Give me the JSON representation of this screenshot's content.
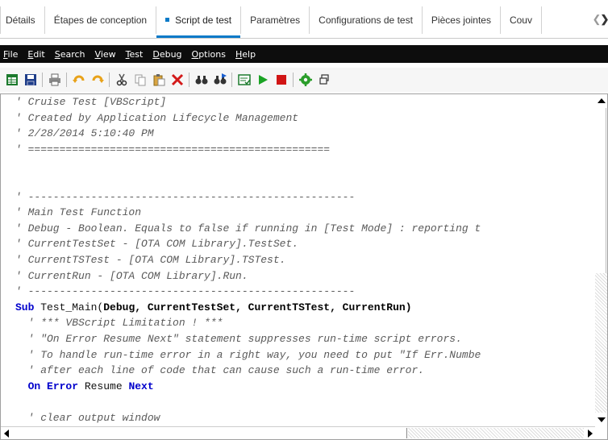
{
  "tabs": [
    {
      "label": "Détails",
      "active": false
    },
    {
      "label": "Étapes de conception",
      "active": false
    },
    {
      "label": "Script de test",
      "active": true
    },
    {
      "label": "Paramètres",
      "active": false
    },
    {
      "label": "Configurations de test",
      "active": false
    },
    {
      "label": "Pièces jointes",
      "active": false
    },
    {
      "label": "Couv",
      "active": false
    }
  ],
  "menu": [
    {
      "label": "File",
      "mnemonic": "F",
      "rest": "ile"
    },
    {
      "label": "Edit",
      "mnemonic": "E",
      "rest": "dit"
    },
    {
      "label": "Search",
      "mnemonic": "S",
      "rest": "earch"
    },
    {
      "label": "View",
      "mnemonic": "V",
      "rest": "iew"
    },
    {
      "label": "Test",
      "mnemonic": "T",
      "rest": "est"
    },
    {
      "label": "Debug",
      "mnemonic": "D",
      "rest": "ebug"
    },
    {
      "label": "Options",
      "mnemonic": "O",
      "rest": "ptions"
    },
    {
      "label": "Help",
      "mnemonic": "H",
      "rest": "elp"
    }
  ],
  "toolbar": {
    "icons": [
      "grid-icon",
      "save-icon",
      "print-icon",
      "undo-icon",
      "redo-icon",
      "cut-icon",
      "copy-icon",
      "paste-icon",
      "delete-icon",
      "find-icon",
      "find-next-icon",
      "syntax-check-icon",
      "run-icon",
      "stop-icon",
      "settings-icon",
      "restore-window-icon"
    ]
  },
  "code_lines": [
    [
      {
        "t": "' Cruise Test [VBScript]",
        "c": "cm"
      }
    ],
    [
      {
        "t": "' Created by Application Lifecycle Management",
        "c": "cm"
      }
    ],
    [
      {
        "t": "' 2/28/2014 5:10:40 PM",
        "c": "cm"
      }
    ],
    [
      {
        "t": "' ================================================",
        "c": "cm"
      }
    ],
    [],
    [],
    [
      {
        "t": "' ----------------------------------------------------",
        "c": "cm"
      }
    ],
    [
      {
        "t": "' Main Test Function",
        "c": "cm"
      }
    ],
    [
      {
        "t": "' Debug - Boolean. Equals to false if running in [Test Mode] : reporting t",
        "c": "cm"
      }
    ],
    [
      {
        "t": "' CurrentTestSet - [OTA COM Library].TestSet.",
        "c": "cm"
      }
    ],
    [
      {
        "t": "' CurrentTSTest - [OTA COM Library].TSTest.",
        "c": "cm"
      }
    ],
    [
      {
        "t": "' CurrentRun - [OTA COM Library].Run.",
        "c": "cm"
      }
    ],
    [
      {
        "t": "' ----------------------------------------------------",
        "c": "cm"
      }
    ],
    [
      {
        "t": "Sub",
        "c": "kw"
      },
      {
        "t": " Test_Main(",
        "c": "tx"
      },
      {
        "t": "Debug, CurrentTestSet, CurrentTSTest, CurrentRun",
        "c": "bd"
      },
      {
        "t": ")",
        "c": "bd"
      }
    ],
    [
      {
        "t": "  ' *** VBScript Limitation ! ***",
        "c": "cm"
      }
    ],
    [
      {
        "t": "  ' \"On Error Resume Next\" statement suppresses run-time script errors.",
        "c": "cm"
      }
    ],
    [
      {
        "t": "  ' To handle run-time error in a right way, you need to put \"If Err.Numbe",
        "c": "cm"
      }
    ],
    [
      {
        "t": "  ' after each line of code that can cause such a run-time error.",
        "c": "cm"
      }
    ],
    [
      {
        "t": "  ",
        "c": "tx"
      },
      {
        "t": "On Error",
        "c": "kw"
      },
      {
        "t": " Resume ",
        "c": "tx"
      },
      {
        "t": "Next",
        "c": "kw"
      }
    ],
    [],
    [
      {
        "t": "  ' clear output window",
        "c": "cm"
      }
    ]
  ]
}
